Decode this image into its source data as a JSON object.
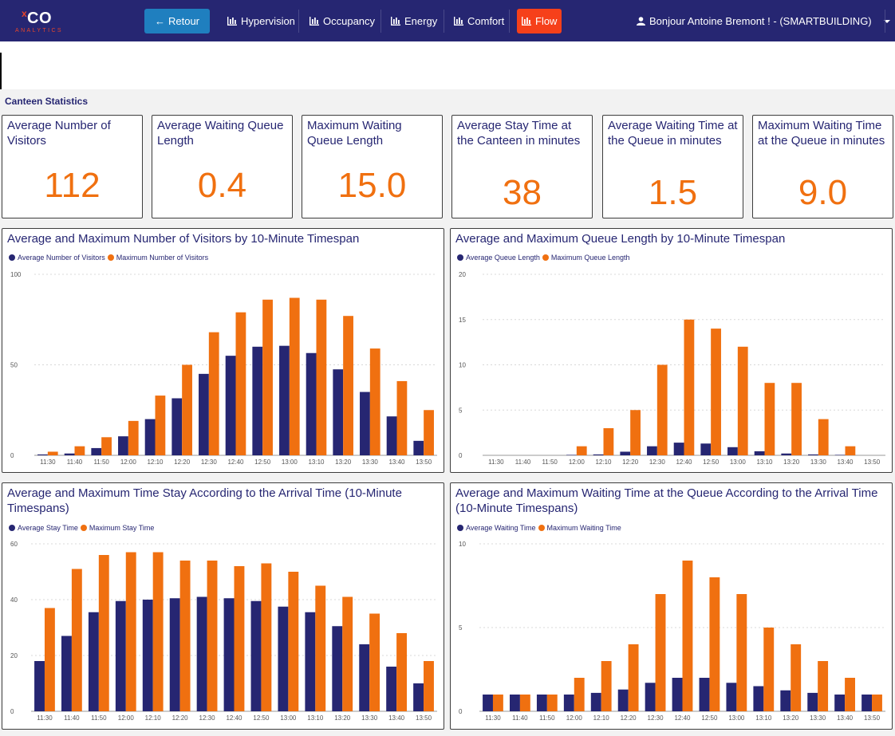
{
  "header": {
    "logo_text": "CO",
    "logo_mark": "x",
    "logo_sub": "ANALYTICS",
    "back_label": "Retour",
    "nav": [
      "Hypervision",
      "Occupancy",
      "Energy",
      "Comfort",
      "Flow"
    ],
    "active_nav": "Flow",
    "user_label": "Bonjour Antoine Bremont ! - (SMARTBUILDING)"
  },
  "colors": {
    "navy": "#262672",
    "orange": "#f07010",
    "active": "#f6401a",
    "back_button": "#1f7fbf"
  },
  "section_title": "Canteen Statistics",
  "kpis": [
    {
      "label": "Average Number of Visitors",
      "value": "112"
    },
    {
      "label": "Average Waiting Queue Length",
      "value": "0.4"
    },
    {
      "label": "Maximum Waiting Queue Length",
      "value": "15.0"
    },
    {
      "label": "Average Stay Time at the Canteen in minutes",
      "value": "38"
    },
    {
      "label": "Average Waiting Time at the Queue in minutes",
      "value": "1.5"
    },
    {
      "label": "Maximum Waiting Time at the Queue in minutes",
      "value": "9.0"
    }
  ],
  "chart_data": [
    {
      "type": "bar",
      "title": "Average and Maximum Number of Visitors by 10-Minute Timespan",
      "categories": [
        "11:30",
        "11:40",
        "11:50",
        "12:00",
        "12:10",
        "12:20",
        "12:30",
        "12:40",
        "12:50",
        "13:00",
        "13:10",
        "13:20",
        "13:30",
        "13:40",
        "13:50"
      ],
      "series": [
        {
          "name": "Average Number of Visitors",
          "values": [
            0.5,
            1,
            4,
            10.5,
            20,
            31.5,
            45,
            55,
            60,
            60.5,
            56.5,
            47.5,
            35,
            21.5,
            8
          ]
        },
        {
          "name": "Maximum Number of Visitors",
          "values": [
            2,
            5,
            10,
            19,
            33,
            50,
            68,
            79,
            86,
            87,
            86,
            77,
            59,
            41,
            25
          ]
        }
      ],
      "ylim": [
        0,
        100
      ],
      "yticks": [
        0,
        50,
        100
      ],
      "grid": true,
      "legend": "top-left"
    },
    {
      "type": "bar",
      "title": "Average and Maximum Queue Length by 10-Minute Timespan",
      "categories": [
        "11:30",
        "11:40",
        "11:50",
        "12:00",
        "12:10",
        "12:20",
        "12:30",
        "12:40",
        "12:50",
        "13:00",
        "13:10",
        "13:20",
        "13:30",
        "13:40",
        "13:50"
      ],
      "series": [
        {
          "name": "Average Queue Length",
          "values": [
            0,
            0,
            0,
            0.05,
            0.1,
            0.4,
            1,
            1.4,
            1.3,
            0.9,
            0.45,
            0.2,
            0.1,
            0.05,
            0
          ]
        },
        {
          "name": "Maximum Queue Length",
          "values": [
            0,
            0,
            0,
            1,
            3,
            5,
            10,
            15,
            14,
            12,
            8,
            8,
            4,
            1,
            0
          ]
        }
      ],
      "ylim": [
        0,
        20
      ],
      "yticks": [
        0,
        5,
        10,
        15,
        20
      ],
      "grid": true,
      "legend": "top-left"
    },
    {
      "type": "bar",
      "title": "Average and Maximum Time Stay According to the Arrival Time (10-Minute Timespans)",
      "categories": [
        "11:30",
        "11:40",
        "11:50",
        "12:00",
        "12:10",
        "12:20",
        "12:30",
        "12:40",
        "12:50",
        "13:00",
        "13:10",
        "13:20",
        "13:30",
        "13:40",
        "13:50"
      ],
      "series": [
        {
          "name": "Average Stay Time",
          "values": [
            18,
            27,
            35.5,
            39.5,
            40,
            40.5,
            41,
            40.5,
            39.5,
            37.5,
            35.5,
            30.5,
            24,
            16,
            10
          ]
        },
        {
          "name": "Maximum Stay Time",
          "values": [
            37,
            51,
            56,
            57,
            57,
            54,
            54,
            52,
            53,
            50,
            45,
            41,
            35,
            28,
            18
          ]
        }
      ],
      "ylim": [
        0,
        60
      ],
      "yticks": [
        0,
        20,
        40,
        60
      ],
      "grid": true,
      "legend": "top-left"
    },
    {
      "type": "bar",
      "title": "Average and Maximum Waiting Time at the Queue According to the Arrival Time (10-Minute Timespans)",
      "categories": [
        "11:30",
        "11:40",
        "11:50",
        "12:00",
        "12:10",
        "12:20",
        "12:30",
        "12:40",
        "12:50",
        "13:00",
        "13:10",
        "13:20",
        "13:30",
        "13:40",
        "13:50"
      ],
      "series": [
        {
          "name": "Average Waiting Time",
          "values": [
            1,
            1,
            1,
            1,
            1.1,
            1.3,
            1.7,
            2,
            2,
            1.7,
            1.5,
            1.25,
            1.1,
            1,
            1
          ]
        },
        {
          "name": "Maximum Waiting Time",
          "values": [
            1,
            1,
            1,
            2,
            3,
            4,
            7,
            9,
            8,
            7,
            5,
            4,
            3,
            2,
            1
          ]
        }
      ],
      "ylim": [
        0,
        10
      ],
      "yticks": [
        0,
        5,
        10
      ],
      "grid": true,
      "legend": "top-left"
    }
  ]
}
